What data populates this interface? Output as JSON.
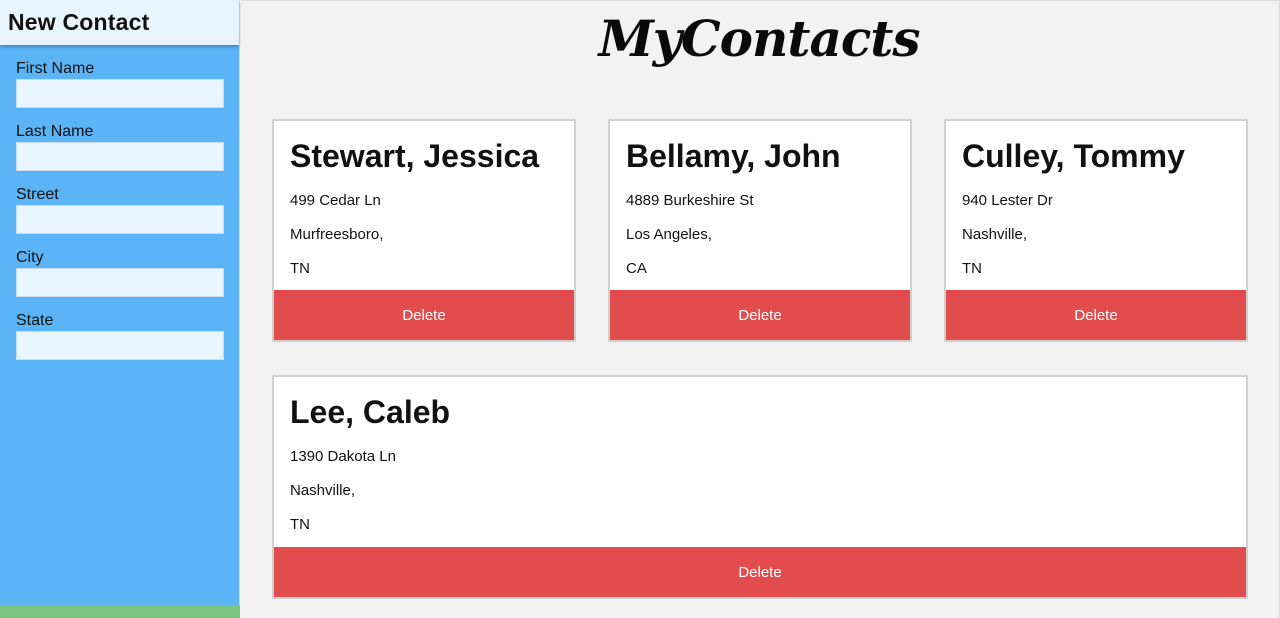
{
  "sidebar": {
    "title": "New Contact",
    "fields": [
      {
        "label": "First Name",
        "value": "",
        "placeholder": ""
      },
      {
        "label": "Last Name",
        "value": "",
        "placeholder": ""
      },
      {
        "label": "Street",
        "value": "",
        "placeholder": ""
      },
      {
        "label": "City",
        "value": "",
        "placeholder": ""
      },
      {
        "label": "State",
        "value": "",
        "placeholder": ""
      }
    ]
  },
  "header": {
    "logo_text": "MyContacts"
  },
  "contacts": [
    {
      "name": "Stewart, Jessica",
      "street": "499 Cedar Ln",
      "city": "Murfreesboro,",
      "state": "TN",
      "delete_label": "Delete"
    },
    {
      "name": "Bellamy, John",
      "street": "4889 Burkeshire St",
      "city": "Los Angeles,",
      "state": "CA",
      "delete_label": "Delete"
    },
    {
      "name": "Culley, Tommy",
      "street": "940 Lester Dr",
      "city": "Nashville,",
      "state": "TN",
      "delete_label": "Delete"
    },
    {
      "name": "Lee, Caleb",
      "street": "1390 Dakota Ln",
      "city": "Nashville,",
      "state": "TN",
      "delete_label": "Delete"
    }
  ],
  "colors": {
    "sidebar_bg": "#5ab4f6",
    "input_bg": "#e9f5fe",
    "delete_bg": "#e34c4c",
    "footer_bar": "#7bc67e",
    "page_bg": "#f2f2f2"
  }
}
